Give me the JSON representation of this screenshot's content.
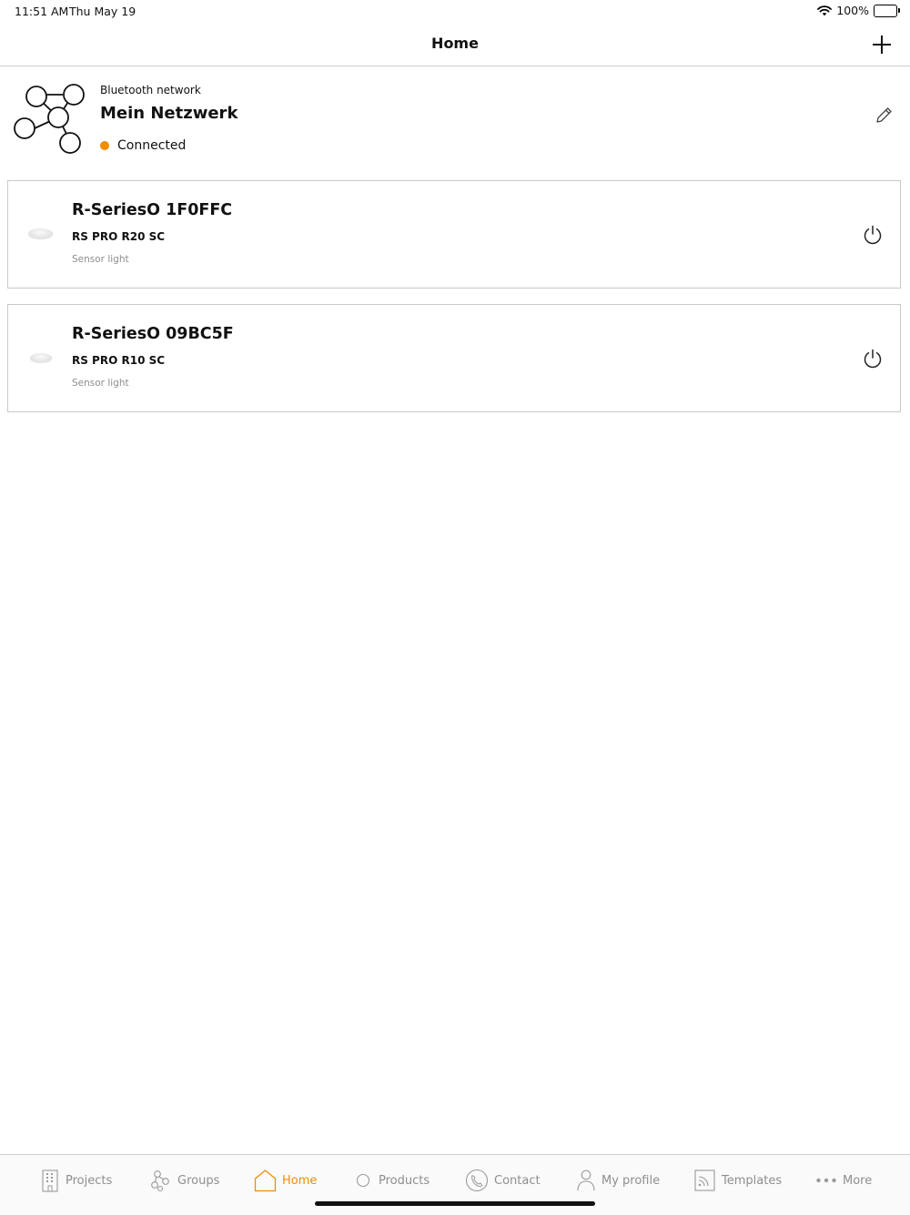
{
  "status": {
    "time": "11:51 AM",
    "date": "Thu May 19",
    "battery": "100%"
  },
  "header": {
    "title": "Home"
  },
  "network": {
    "label": "Bluetooth network",
    "name": "Mein Netzwerk",
    "status": "Connected",
    "status_color": "#f28c00"
  },
  "devices": [
    {
      "name": "R-SeriesO 1F0FFC",
      "model": "RS PRO R20 SC",
      "type": "Sensor light"
    },
    {
      "name": "R-SeriesO 09BC5F",
      "model": "RS PRO R10 SC",
      "type": "Sensor light"
    }
  ],
  "tabs": [
    {
      "label": "Projects",
      "icon": "building-icon"
    },
    {
      "label": "Groups",
      "icon": "groups-icon"
    },
    {
      "label": "Home",
      "icon": "home-icon",
      "active": true
    },
    {
      "label": "Products",
      "icon": "products-icon"
    },
    {
      "label": "Contact",
      "icon": "phone-icon"
    },
    {
      "label": "My profile",
      "icon": "profile-icon"
    },
    {
      "label": "Templates",
      "icon": "templates-icon"
    },
    {
      "label": "More",
      "icon": "more-icon"
    }
  ],
  "colors": {
    "accent": "#f28c00",
    "inactive": "#8e8e8e",
    "border": "#c9c9c9"
  }
}
